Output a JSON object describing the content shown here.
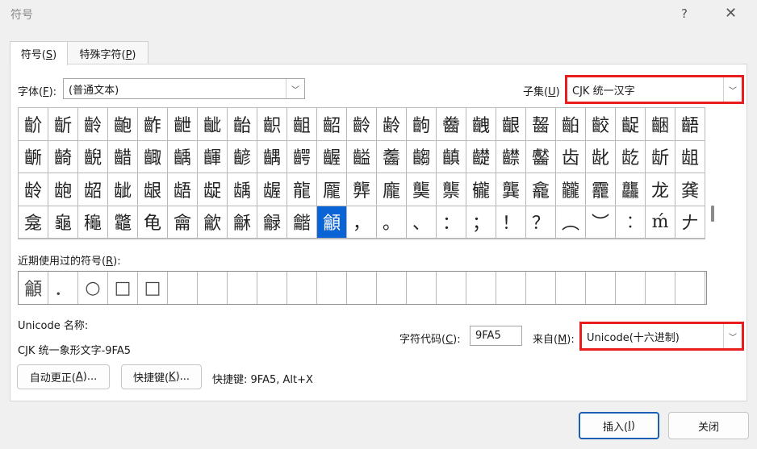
{
  "window": {
    "title": "符号",
    "help": "?",
    "close": "✕"
  },
  "tabs": [
    {
      "label": "符号(",
      "key": "S",
      "tail": ")"
    },
    {
      "label": "特殊字符(",
      "key": "P",
      "tail": ")"
    }
  ],
  "font": {
    "label": "字体(",
    "key": "F",
    "tail": "):",
    "value": "(普通文本)"
  },
  "subset": {
    "label": "子集(",
    "key": "U",
    "tail": ")",
    "value": "CJK 统一汉字"
  },
  "grid": {
    "selected_index": 79,
    "cells": [
      "齘",
      "齗",
      "齡",
      "齙",
      "齚",
      "齛",
      "齜",
      "齝",
      "齞",
      "齟",
      "齠",
      "齡",
      "齢",
      "齣",
      "齤",
      "齥",
      "齦",
      "齧",
      "齨",
      "齩",
      "齪",
      "齫",
      "齬",
      "齭",
      "齮",
      "齯",
      "齰",
      "齱",
      "齲",
      "齳",
      "齴",
      "齵",
      "齶",
      "齷",
      "齸",
      "齹",
      "齺",
      "齻",
      "齼",
      "齽",
      "齾",
      "齿",
      "龀",
      "龁",
      "龂",
      "龃",
      "龄",
      "龅",
      "龆",
      "龇",
      "龈",
      "龉",
      "龊",
      "龋",
      "龌",
      "龍",
      "龎",
      "龏",
      "龐",
      "龑",
      "龒",
      "龓",
      "龔",
      "龕",
      "龖",
      "龗",
      "龘",
      "龙",
      "龚",
      "龛",
      "龜",
      "龝",
      "龞",
      "龟",
      "龠",
      "龡",
      "龢",
      "龣",
      "龤",
      "龥",
      "，",
      "。",
      "、",
      "：",
      "；",
      "！",
      "？",
      "︵",
      "︶",
      "︰",
      "ḿ",
      "𠂇"
    ]
  },
  "recent": {
    "label": "近期使用过的符号(",
    "key": "R",
    "tail": "):",
    "items": [
      "龥",
      "．",
      "○",
      "□",
      "□",
      "",
      "",
      "",
      "",
      "",
      "",
      "",
      "",
      "",
      "",
      "",
      "",
      "",
      "",
      "",
      "",
      "",
      ""
    ]
  },
  "unicode": {
    "name_label": "Unicode 名称:",
    "name_value": "CJK 统一象形文字-9FA5"
  },
  "charcode": {
    "label": "字符代码(",
    "key": "C",
    "tail": "):",
    "value": "9FA5"
  },
  "from": {
    "label": "来自(",
    "key": "M",
    "tail": "):",
    "value": "Unicode(十六进制)"
  },
  "buttons": {
    "autocorrect": {
      "label": "自动更正(",
      "key": "A",
      "tail": ")..."
    },
    "shortcut_key": {
      "label": "快捷键(",
      "key": "K",
      "tail": ")..."
    },
    "insert": {
      "label": "插入(",
      "key": "I",
      "tail": ")"
    },
    "close": "关闭"
  },
  "shortcut_text": "快捷键: 9FA5, Alt+X"
}
